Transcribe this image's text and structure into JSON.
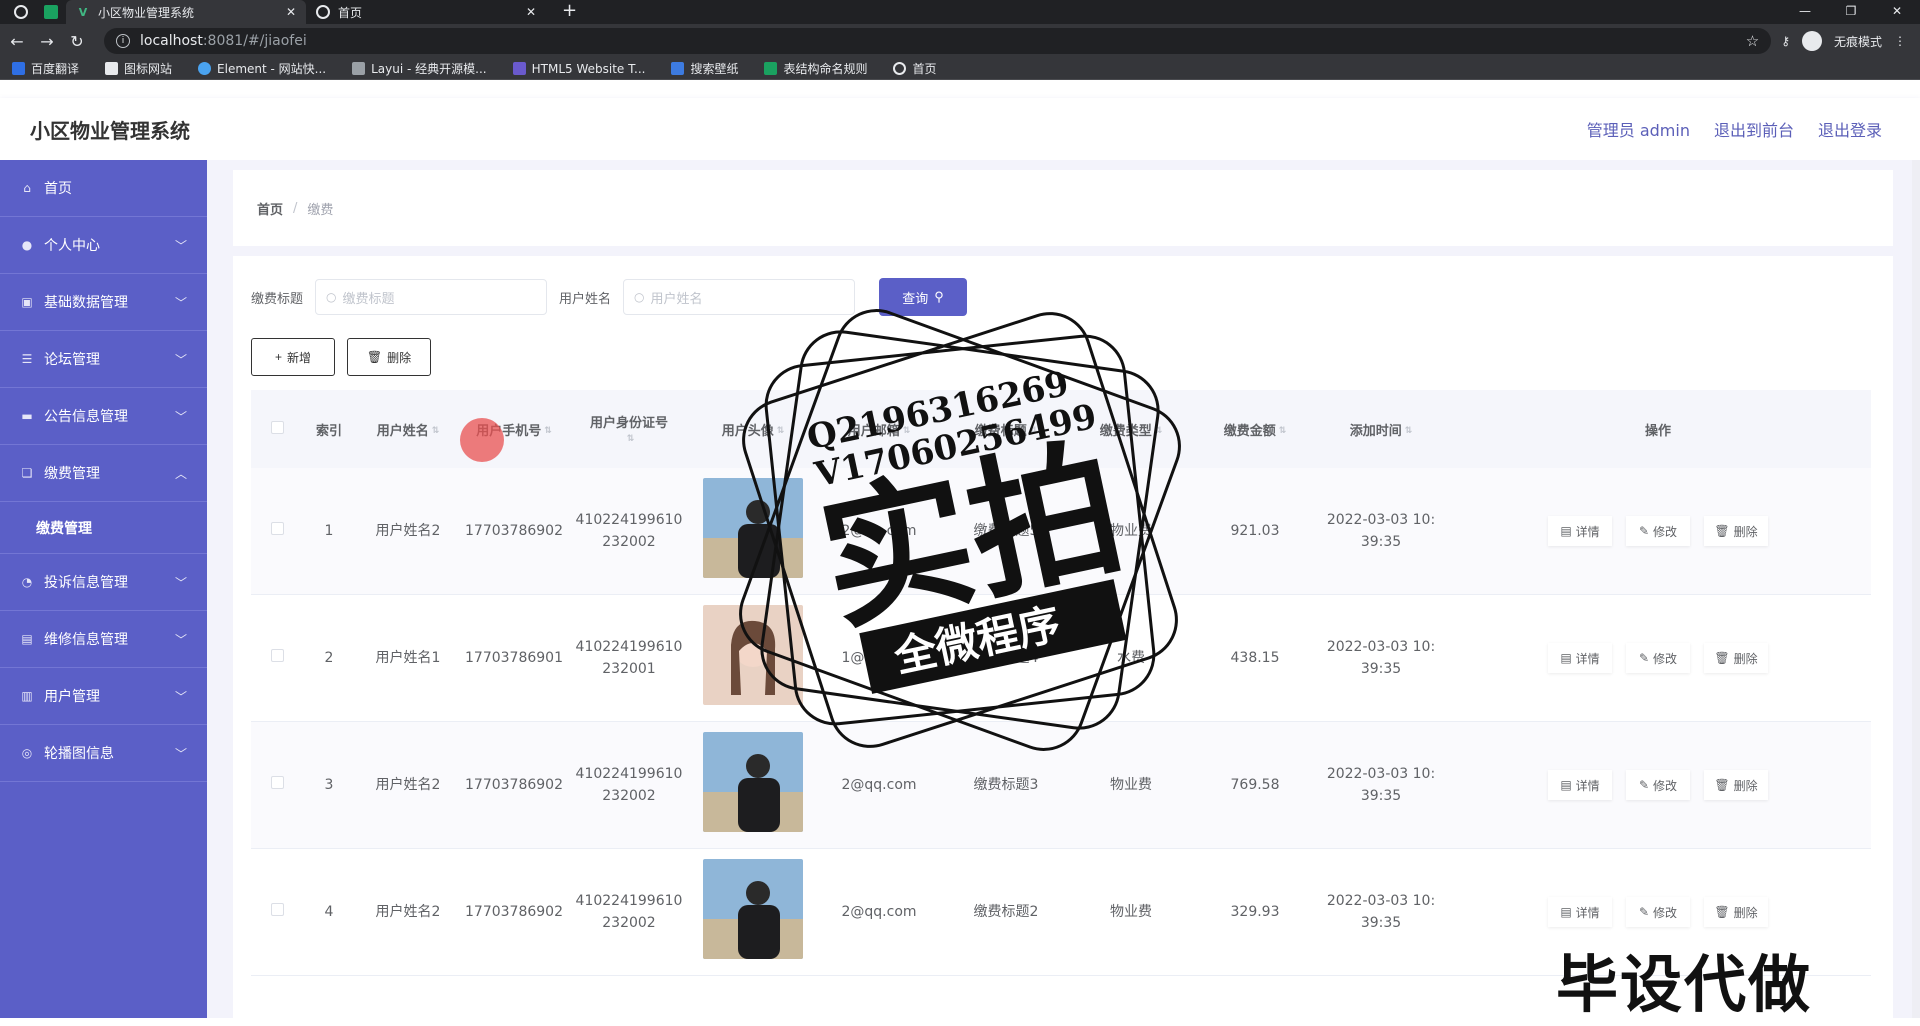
{
  "browser": {
    "tabs": [
      {
        "title": "小区物业管理系统",
        "active": true
      },
      {
        "title": "首页",
        "active": false
      }
    ],
    "url_host": "localhost",
    "url_path": ":8081/#/jiaofei",
    "incognito_label": "无痕模式",
    "bookmarks": [
      "百度翻译",
      "图标网站",
      "Element - 网站快...",
      "Layui - 经典开源模...",
      "HTML5 Website T...",
      "搜索壁纸",
      "表结构命名规则",
      "首页"
    ]
  },
  "header": {
    "title": "小区物业管理系统",
    "admin_link": "管理员 admin",
    "front_link": "退出到前台",
    "logout_link": "退出登录"
  },
  "sidebar": {
    "items": [
      {
        "label": "首页"
      },
      {
        "label": "个人中心"
      },
      {
        "label": "基础数据管理"
      },
      {
        "label": "论坛管理"
      },
      {
        "label": "公告信息管理"
      },
      {
        "label": "缴费管理"
      },
      {
        "label": "缴费管理"
      },
      {
        "label": "投诉信息管理"
      },
      {
        "label": "维修信息管理"
      },
      {
        "label": "用户管理"
      },
      {
        "label": "轮播图信息"
      }
    ]
  },
  "breadcrumb": {
    "home": "首页",
    "separator": "/",
    "current": "缴费"
  },
  "search": {
    "title_label": "缴费标题",
    "title_placeholder": "缴费标题",
    "user_label": "用户姓名",
    "user_placeholder": "用户姓名",
    "query_label": "查询"
  },
  "actions": {
    "add_label": "新增",
    "delete_label": "删除"
  },
  "table": {
    "headers": [
      "索引",
      "用户姓名",
      "用户手机号",
      "用户身份证号",
      "用户头像",
      "用户邮箱",
      "缴费标题",
      "缴费类型",
      "缴费金额",
      "添加时间",
      "操作"
    ],
    "rows": [
      {
        "index": "1",
        "name": "用户姓名2",
        "phone": "17703786902",
        "id_line1": "410224199610",
        "id_line2": "232002",
        "email": "2@qq.com",
        "fee_title": "缴费标题5",
        "fee_type": "物业费",
        "amount": "921.03",
        "time_line1": "2022-03-03 10:",
        "time_line2": "39:35"
      },
      {
        "index": "2",
        "name": "用户姓名1",
        "phone": "17703786901",
        "id_line1": "410224199610",
        "id_line2": "232001",
        "email": "1@qq.com",
        "fee_title": "缴费标题4",
        "fee_type": "水费",
        "amount": "438.15",
        "time_line1": "2022-03-03 10:",
        "time_line2": "39:35"
      },
      {
        "index": "3",
        "name": "用户姓名2",
        "phone": "17703786902",
        "id_line1": "410224199610",
        "id_line2": "232002",
        "email": "2@qq.com",
        "fee_title": "缴费标题3",
        "fee_type": "物业费",
        "amount": "769.58",
        "time_line1": "2022-03-03 10:",
        "time_line2": "39:35"
      },
      {
        "index": "4",
        "name": "用户姓名2",
        "phone": "17703786902",
        "id_line1": "410224199610",
        "id_line2": "232002",
        "email": "2@qq.com",
        "fee_title": "缴费标题2",
        "fee_type": "物业费",
        "amount": "329.93",
        "time_line1": "2022-03-03 10:",
        "time_line2": "39:35"
      }
    ],
    "row_actions": {
      "detail": "详情",
      "edit": "修改",
      "delete": "删除"
    }
  },
  "watermark": {
    "qq": "Q2196316269",
    "vx": "V17060256499",
    "big": "实拍",
    "banner": "全微程序",
    "corner": "毕设代做"
  },
  "colors": {
    "primary": "#5b5fc7",
    "header_text": "#5b5fb8"
  }
}
